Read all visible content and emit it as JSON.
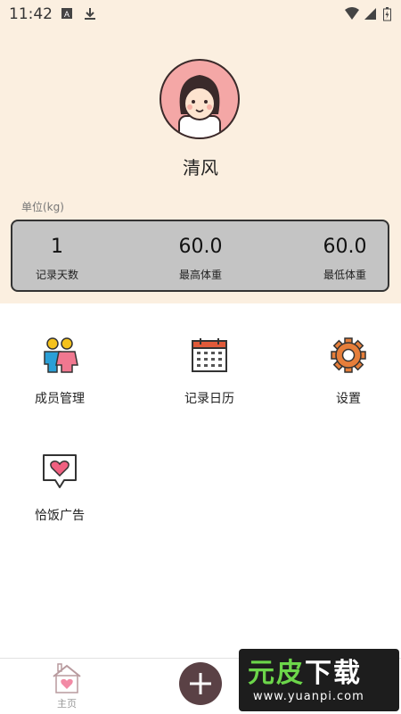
{
  "status_bar": {
    "time": "11:42"
  },
  "profile": {
    "name": "清风",
    "unit_label": "单位(kg)"
  },
  "stats": [
    {
      "value": "1",
      "label": "记录天数"
    },
    {
      "value": "60.0",
      "label": "最高体重"
    },
    {
      "value": "60.0",
      "label": "最低体重"
    }
  ],
  "menu": [
    {
      "label": "成员管理",
      "icon": "members-icon"
    },
    {
      "label": "记录日历",
      "icon": "calendar-icon"
    },
    {
      "label": "设置",
      "icon": "gear-icon"
    },
    {
      "label": "恰饭广告",
      "icon": "heart-message-icon"
    }
  ],
  "bottom_nav": {
    "home_label": "主页"
  },
  "watermark": {
    "title_a": "元皮",
    "title_b": "下载",
    "url": "www.yuanpi.com"
  },
  "colors": {
    "header_bg": "#fbefe0",
    "add_button": "#5a4145",
    "avatar_bg": "#f4a7a6"
  }
}
